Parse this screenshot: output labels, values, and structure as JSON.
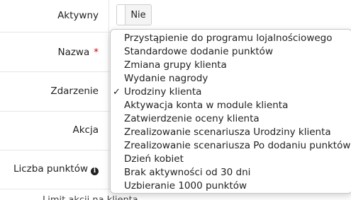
{
  "form": {
    "active_label": "Aktywny",
    "active_toggle_value": "Nie",
    "name_label": "Nazwa",
    "required_mark": "*",
    "event_label": "Zdarzenie",
    "action_label": "Akcja",
    "points_label": "Liczba punktów",
    "info_icon_glyph": "i",
    "next_label_partial": "Limit akcji na klienta"
  },
  "event_dropdown": {
    "selected": "Urodziny klienta",
    "check_glyph": "✓",
    "options": [
      "Przystąpienie do programu lojalnościowego",
      "Standardowe dodanie punktów",
      "Zmiana grupy klienta",
      "Wydanie nagrody",
      "Urodziny klienta",
      "Aktywacja konta w module klienta",
      "Zatwierdzenie oceny klienta",
      "Zrealizowanie scenariusza Urodziny klienta",
      "Zrealizowanie scenariusza Po dodaniu punktów",
      "Dzień kobiet",
      "Brak aktywności od 30 dni",
      "Uzbieranie 1000 punktów"
    ]
  },
  "icons": {
    "info": "info-circle-icon",
    "check": "checkmark-icon"
  },
  "colors": {
    "required": "#cc0000",
    "border": "#e6e6e6"
  }
}
